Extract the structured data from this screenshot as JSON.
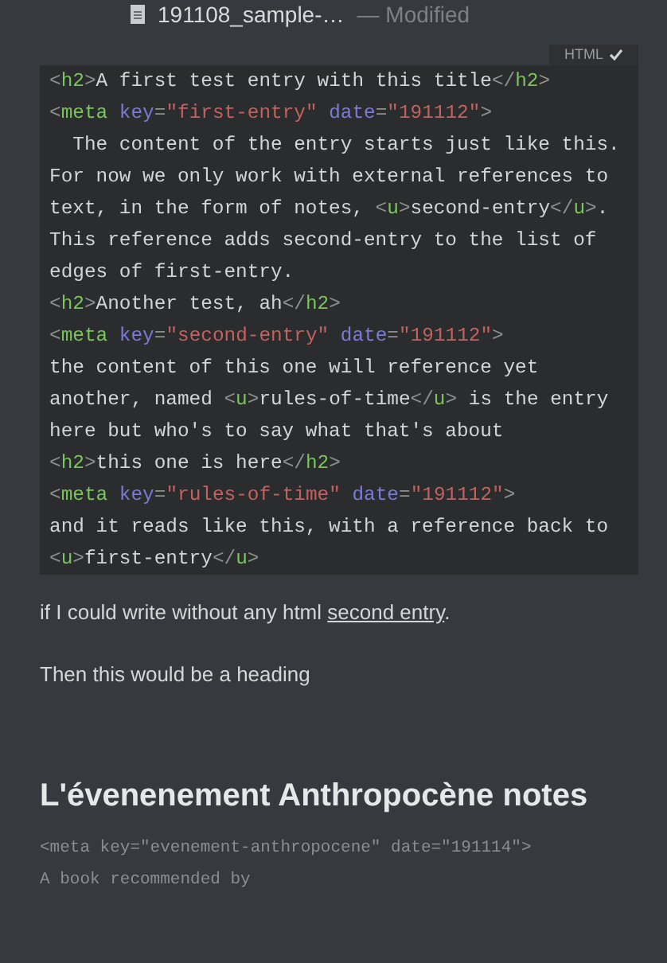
{
  "window": {
    "title": "191108_sample-…",
    "status": "— Modified"
  },
  "code_block": {
    "language": "HTML",
    "verified": true,
    "lines": [
      [
        {
          "kind": "punct",
          "text": "<"
        },
        {
          "kind": "tag",
          "text": "h2"
        },
        {
          "kind": "punct",
          "text": ">"
        },
        {
          "kind": "text",
          "text": "A first test entry with this title"
        },
        {
          "kind": "punct",
          "text": "</"
        },
        {
          "kind": "tag",
          "text": "h2"
        },
        {
          "kind": "punct",
          "text": ">"
        }
      ],
      [
        {
          "kind": "punct",
          "text": "<"
        },
        {
          "kind": "tag",
          "text": "meta"
        },
        {
          "kind": "attr",
          "text": " key"
        },
        {
          "kind": "punct",
          "text": "="
        },
        {
          "kind": "string",
          "text": "\"first-entry\""
        },
        {
          "kind": "attr",
          "text": " date"
        },
        {
          "kind": "punct",
          "text": "="
        },
        {
          "kind": "string",
          "text": "\"191112\""
        },
        {
          "kind": "punct",
          "text": ">"
        }
      ],
      [
        {
          "kind": "text",
          "text": "  The content of the entry starts just like this."
        }
      ],
      [
        {
          "kind": "text",
          "text": "For now we only work with external references to"
        }
      ],
      [
        {
          "kind": "text",
          "text": "text, in the form of notes, "
        },
        {
          "kind": "punct",
          "text": "<"
        },
        {
          "kind": "tag",
          "text": "u"
        },
        {
          "kind": "punct",
          "text": ">"
        },
        {
          "kind": "text",
          "text": "second-entry"
        },
        {
          "kind": "punct",
          "text": "</"
        },
        {
          "kind": "tag",
          "text": "u"
        },
        {
          "kind": "punct",
          "text": ">"
        },
        {
          "kind": "text",
          "text": "."
        }
      ],
      [
        {
          "kind": "text",
          "text": "This reference adds second-entry to the list of"
        }
      ],
      [
        {
          "kind": "text",
          "text": "edges of first-entry."
        }
      ],
      [
        {
          "kind": "punct",
          "text": "<"
        },
        {
          "kind": "tag",
          "text": "h2"
        },
        {
          "kind": "punct",
          "text": ">"
        },
        {
          "kind": "text",
          "text": "Another test, ah"
        },
        {
          "kind": "punct",
          "text": "</"
        },
        {
          "kind": "tag",
          "text": "h2"
        },
        {
          "kind": "punct",
          "text": ">"
        }
      ],
      [
        {
          "kind": "punct",
          "text": "<"
        },
        {
          "kind": "tag",
          "text": "meta"
        },
        {
          "kind": "attr",
          "text": " key"
        },
        {
          "kind": "punct",
          "text": "="
        },
        {
          "kind": "string",
          "text": "\"second-entry\""
        },
        {
          "kind": "attr",
          "text": " date"
        },
        {
          "kind": "punct",
          "text": "="
        },
        {
          "kind": "string",
          "text": "\"191112\""
        },
        {
          "kind": "punct",
          "text": ">"
        }
      ],
      [
        {
          "kind": "text",
          "text": "the content of this one will reference yet"
        }
      ],
      [
        {
          "kind": "text",
          "text": "another, named "
        },
        {
          "kind": "punct",
          "text": "<"
        },
        {
          "kind": "tag",
          "text": "u"
        },
        {
          "kind": "punct",
          "text": ">"
        },
        {
          "kind": "text",
          "text": "rules-of-time"
        },
        {
          "kind": "punct",
          "text": "</"
        },
        {
          "kind": "tag",
          "text": "u"
        },
        {
          "kind": "punct",
          "text": ">"
        },
        {
          "kind": "text",
          "text": " is the entry"
        }
      ],
      [
        {
          "kind": "text",
          "text": "here but who's to say what that's about"
        }
      ],
      [
        {
          "kind": "punct",
          "text": "<"
        },
        {
          "kind": "tag",
          "text": "h2"
        },
        {
          "kind": "punct",
          "text": ">"
        },
        {
          "kind": "text",
          "text": "this one is here"
        },
        {
          "kind": "punct",
          "text": "</"
        },
        {
          "kind": "tag",
          "text": "h2"
        },
        {
          "kind": "punct",
          "text": ">"
        }
      ],
      [
        {
          "kind": "punct",
          "text": "<"
        },
        {
          "kind": "tag",
          "text": "meta"
        },
        {
          "kind": "attr",
          "text": " key"
        },
        {
          "kind": "punct",
          "text": "="
        },
        {
          "kind": "string",
          "text": "\"rules-of-time\""
        },
        {
          "kind": "attr",
          "text": " date"
        },
        {
          "kind": "punct",
          "text": "="
        },
        {
          "kind": "string",
          "text": "\"191112\""
        },
        {
          "kind": "punct",
          "text": ">"
        }
      ],
      [
        {
          "kind": "text",
          "text": "and it reads like this, with a reference back to"
        }
      ],
      [
        {
          "kind": "punct",
          "text": "<"
        },
        {
          "kind": "tag",
          "text": "u"
        },
        {
          "kind": "punct",
          "text": ">"
        },
        {
          "kind": "text",
          "text": "first-entry"
        },
        {
          "kind": "punct",
          "text": "</"
        },
        {
          "kind": "tag",
          "text": "u"
        },
        {
          "kind": "punct",
          "text": ">"
        }
      ]
    ]
  },
  "paragraphs": [
    {
      "text": "if I could write without any html ",
      "link": "second entry",
      "after": "."
    },
    {
      "text": "Then this would be a heading"
    }
  ],
  "heading": "L'évenenement Anthropocène notes",
  "raw_lines": [
    "<meta key=\"evenement-anthropocene\" date=\"191114\">",
    "A book recommended by"
  ]
}
